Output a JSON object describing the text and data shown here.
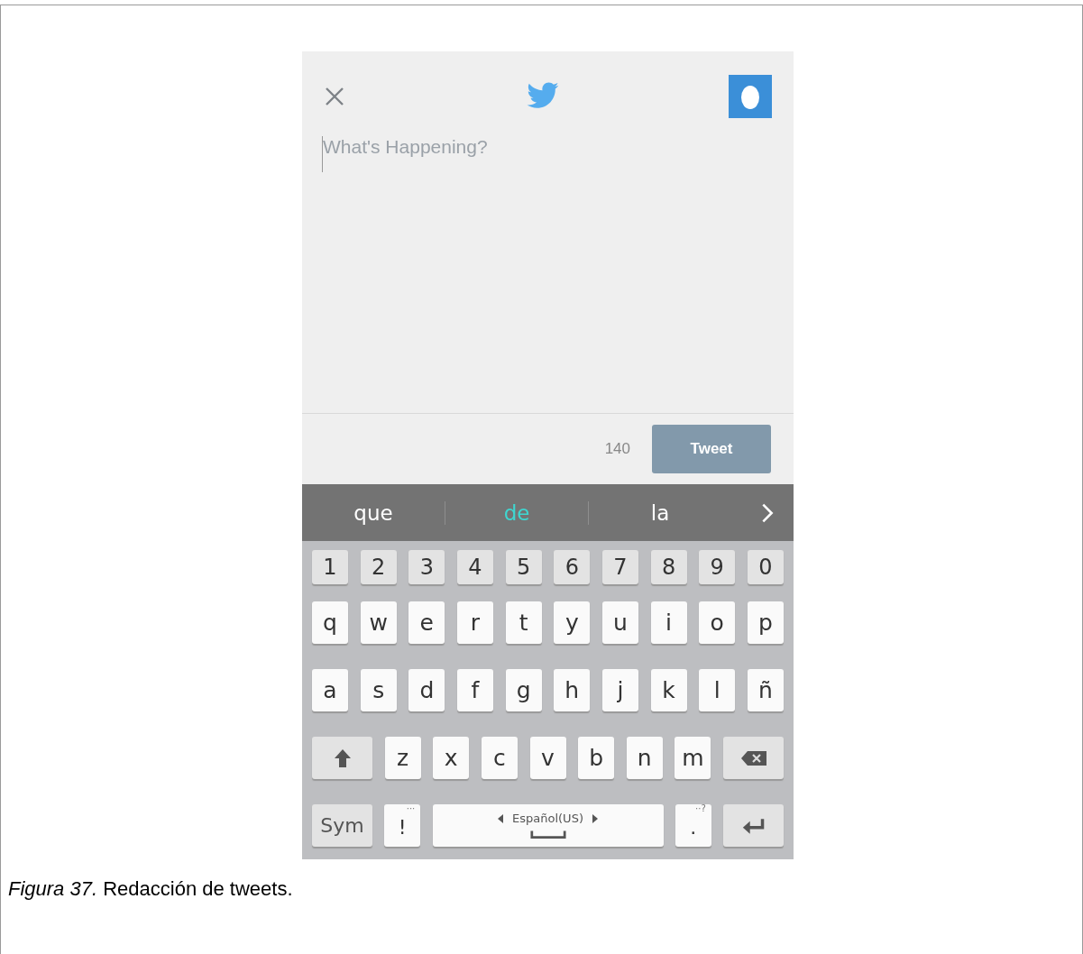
{
  "compose": {
    "placeholder": "What's Happening?",
    "counter": "140",
    "tweet_button": {
      "label": "Tweet",
      "disabled": true
    }
  },
  "suggestions": [
    {
      "label": "que",
      "selected": false
    },
    {
      "label": "de",
      "selected": true
    },
    {
      "label": "la",
      "selected": false
    }
  ],
  "keyboard": {
    "rows": [
      {
        "keys": [
          {
            "kind": "number",
            "label": "1"
          },
          {
            "kind": "number",
            "label": "2"
          },
          {
            "kind": "number",
            "label": "3"
          },
          {
            "kind": "number",
            "label": "4"
          },
          {
            "kind": "number",
            "label": "5"
          },
          {
            "kind": "number",
            "label": "6"
          },
          {
            "kind": "number",
            "label": "7"
          },
          {
            "kind": "number",
            "label": "8"
          },
          {
            "kind": "number",
            "label": "9"
          },
          {
            "kind": "number",
            "label": "0"
          }
        ]
      },
      {
        "keys": [
          {
            "kind": "letter",
            "label": "q"
          },
          {
            "kind": "letter",
            "label": "w"
          },
          {
            "kind": "letter",
            "label": "e"
          },
          {
            "kind": "letter",
            "label": "r"
          },
          {
            "kind": "letter",
            "label": "t"
          },
          {
            "kind": "letter",
            "label": "y"
          },
          {
            "kind": "letter",
            "label": "u"
          },
          {
            "kind": "letter",
            "label": "i"
          },
          {
            "kind": "letter",
            "label": "o"
          },
          {
            "kind": "letter",
            "label": "p"
          }
        ]
      },
      {
        "keys": [
          {
            "kind": "letter",
            "label": "a"
          },
          {
            "kind": "letter",
            "label": "s"
          },
          {
            "kind": "letter",
            "label": "d"
          },
          {
            "kind": "letter",
            "label": "f"
          },
          {
            "kind": "letter",
            "label": "g"
          },
          {
            "kind": "letter",
            "label": "h"
          },
          {
            "kind": "letter",
            "label": "j"
          },
          {
            "kind": "letter",
            "label": "k"
          },
          {
            "kind": "letter",
            "label": "l"
          },
          {
            "kind": "letter",
            "label": "ñ"
          }
        ]
      },
      {
        "keys": [
          {
            "kind": "shift"
          },
          {
            "kind": "letter",
            "label": "z"
          },
          {
            "kind": "letter",
            "label": "x"
          },
          {
            "kind": "letter",
            "label": "c"
          },
          {
            "kind": "letter",
            "label": "v"
          },
          {
            "kind": "letter",
            "label": "b"
          },
          {
            "kind": "letter",
            "label": "n"
          },
          {
            "kind": "letter",
            "label": "m"
          },
          {
            "kind": "backspace"
          }
        ]
      },
      {
        "keys": [
          {
            "kind": "sym",
            "label": "Sym"
          },
          {
            "kind": "punct",
            "label": "!",
            "hint": "···"
          },
          {
            "kind": "space",
            "label": "Español(US)"
          },
          {
            "kind": "punct",
            "label": ".",
            "hint": "··?"
          },
          {
            "kind": "enter"
          }
        ]
      }
    ]
  },
  "caption": "*Figura 37.* Redacción de tweets."
}
